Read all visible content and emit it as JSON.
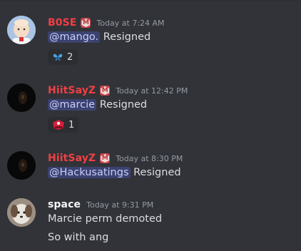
{
  "messages": [
    {
      "username": "B0SE",
      "username_color": "#f23f43",
      "badge": "M",
      "timestamp": "Today at 7:24 AM",
      "mention": "@mango.",
      "text": "Resigned",
      "reaction": {
        "icon": "butterfly-emoji",
        "count": "2"
      }
    },
    {
      "username": "HiitSayZ",
      "username_color": "#f23f43",
      "badge": "M",
      "timestamp": "Today at 12:42 PM",
      "mention": "@marcie",
      "text": "Resigned",
      "reaction": {
        "icon": "red-emblem-emoji",
        "count": "1"
      }
    },
    {
      "username": "HiitSayZ",
      "username_color": "#f23f43",
      "badge": "M",
      "timestamp": "Today at 8:30 PM",
      "mention": "@Hackusatings",
      "text": "Resigned"
    },
    {
      "username": "space",
      "username_color": "#f2f3f5",
      "timestamp": "Today at 9:31 PM",
      "lines": [
        "Marcie perm demoted",
        "So with ang"
      ]
    }
  ],
  "colors": {
    "background": "#313338",
    "mention_bg": "#3c4270",
    "mention_fg": "#c9cdfb",
    "muted": "#949ba4"
  }
}
